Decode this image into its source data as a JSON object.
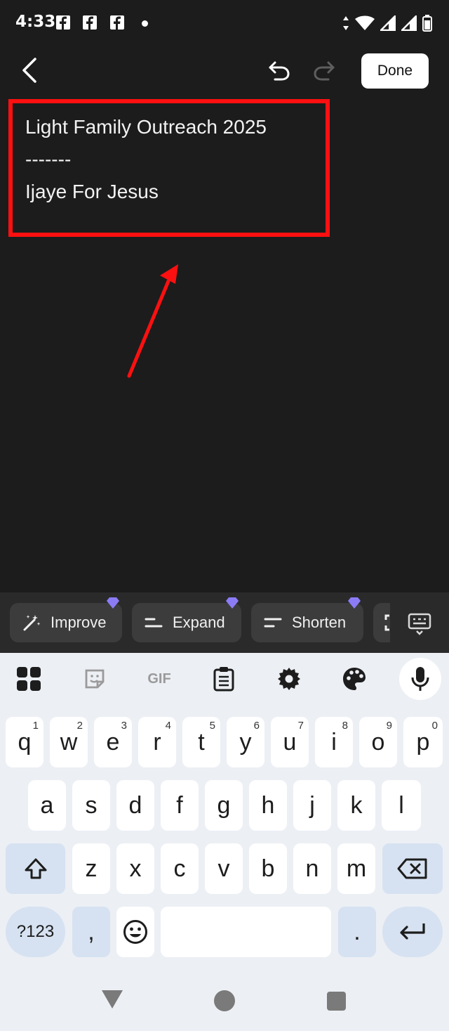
{
  "status_bar": {
    "time": "4:33"
  },
  "header": {
    "done_label": "Done"
  },
  "editor": {
    "lines": [
      "Light Family Outreach 2025",
      "-------",
      "Ijaye For Jesus"
    ]
  },
  "ai_bar": {
    "chips": [
      {
        "label": "Improve"
      },
      {
        "label": "Expand"
      },
      {
        "label": "Shorten"
      }
    ]
  },
  "keyboard": {
    "toolbar": {
      "gif_label": "GIF"
    },
    "row1": [
      {
        "key": "q",
        "hint": "1"
      },
      {
        "key": "w",
        "hint": "2"
      },
      {
        "key": "e",
        "hint": "3"
      },
      {
        "key": "r",
        "hint": "4"
      },
      {
        "key": "t",
        "hint": "5"
      },
      {
        "key": "y",
        "hint": "6"
      },
      {
        "key": "u",
        "hint": "7"
      },
      {
        "key": "i",
        "hint": "8"
      },
      {
        "key": "o",
        "hint": "9"
      },
      {
        "key": "p",
        "hint": "0"
      }
    ],
    "row2": [
      "a",
      "s",
      "d",
      "f",
      "g",
      "h",
      "j",
      "k",
      "l"
    ],
    "row3": [
      "z",
      "x",
      "c",
      "v",
      "b",
      "n",
      "m"
    ],
    "symbols_label": "?123",
    "comma_label": ",",
    "period_label": "."
  },
  "colors": {
    "background": "#1c1c1c",
    "annotation_red": "#ff1010",
    "keyboard_bg": "#eceff4",
    "modifier_key": "#d6e2f1",
    "premium_gem": "#8b7cf6"
  }
}
